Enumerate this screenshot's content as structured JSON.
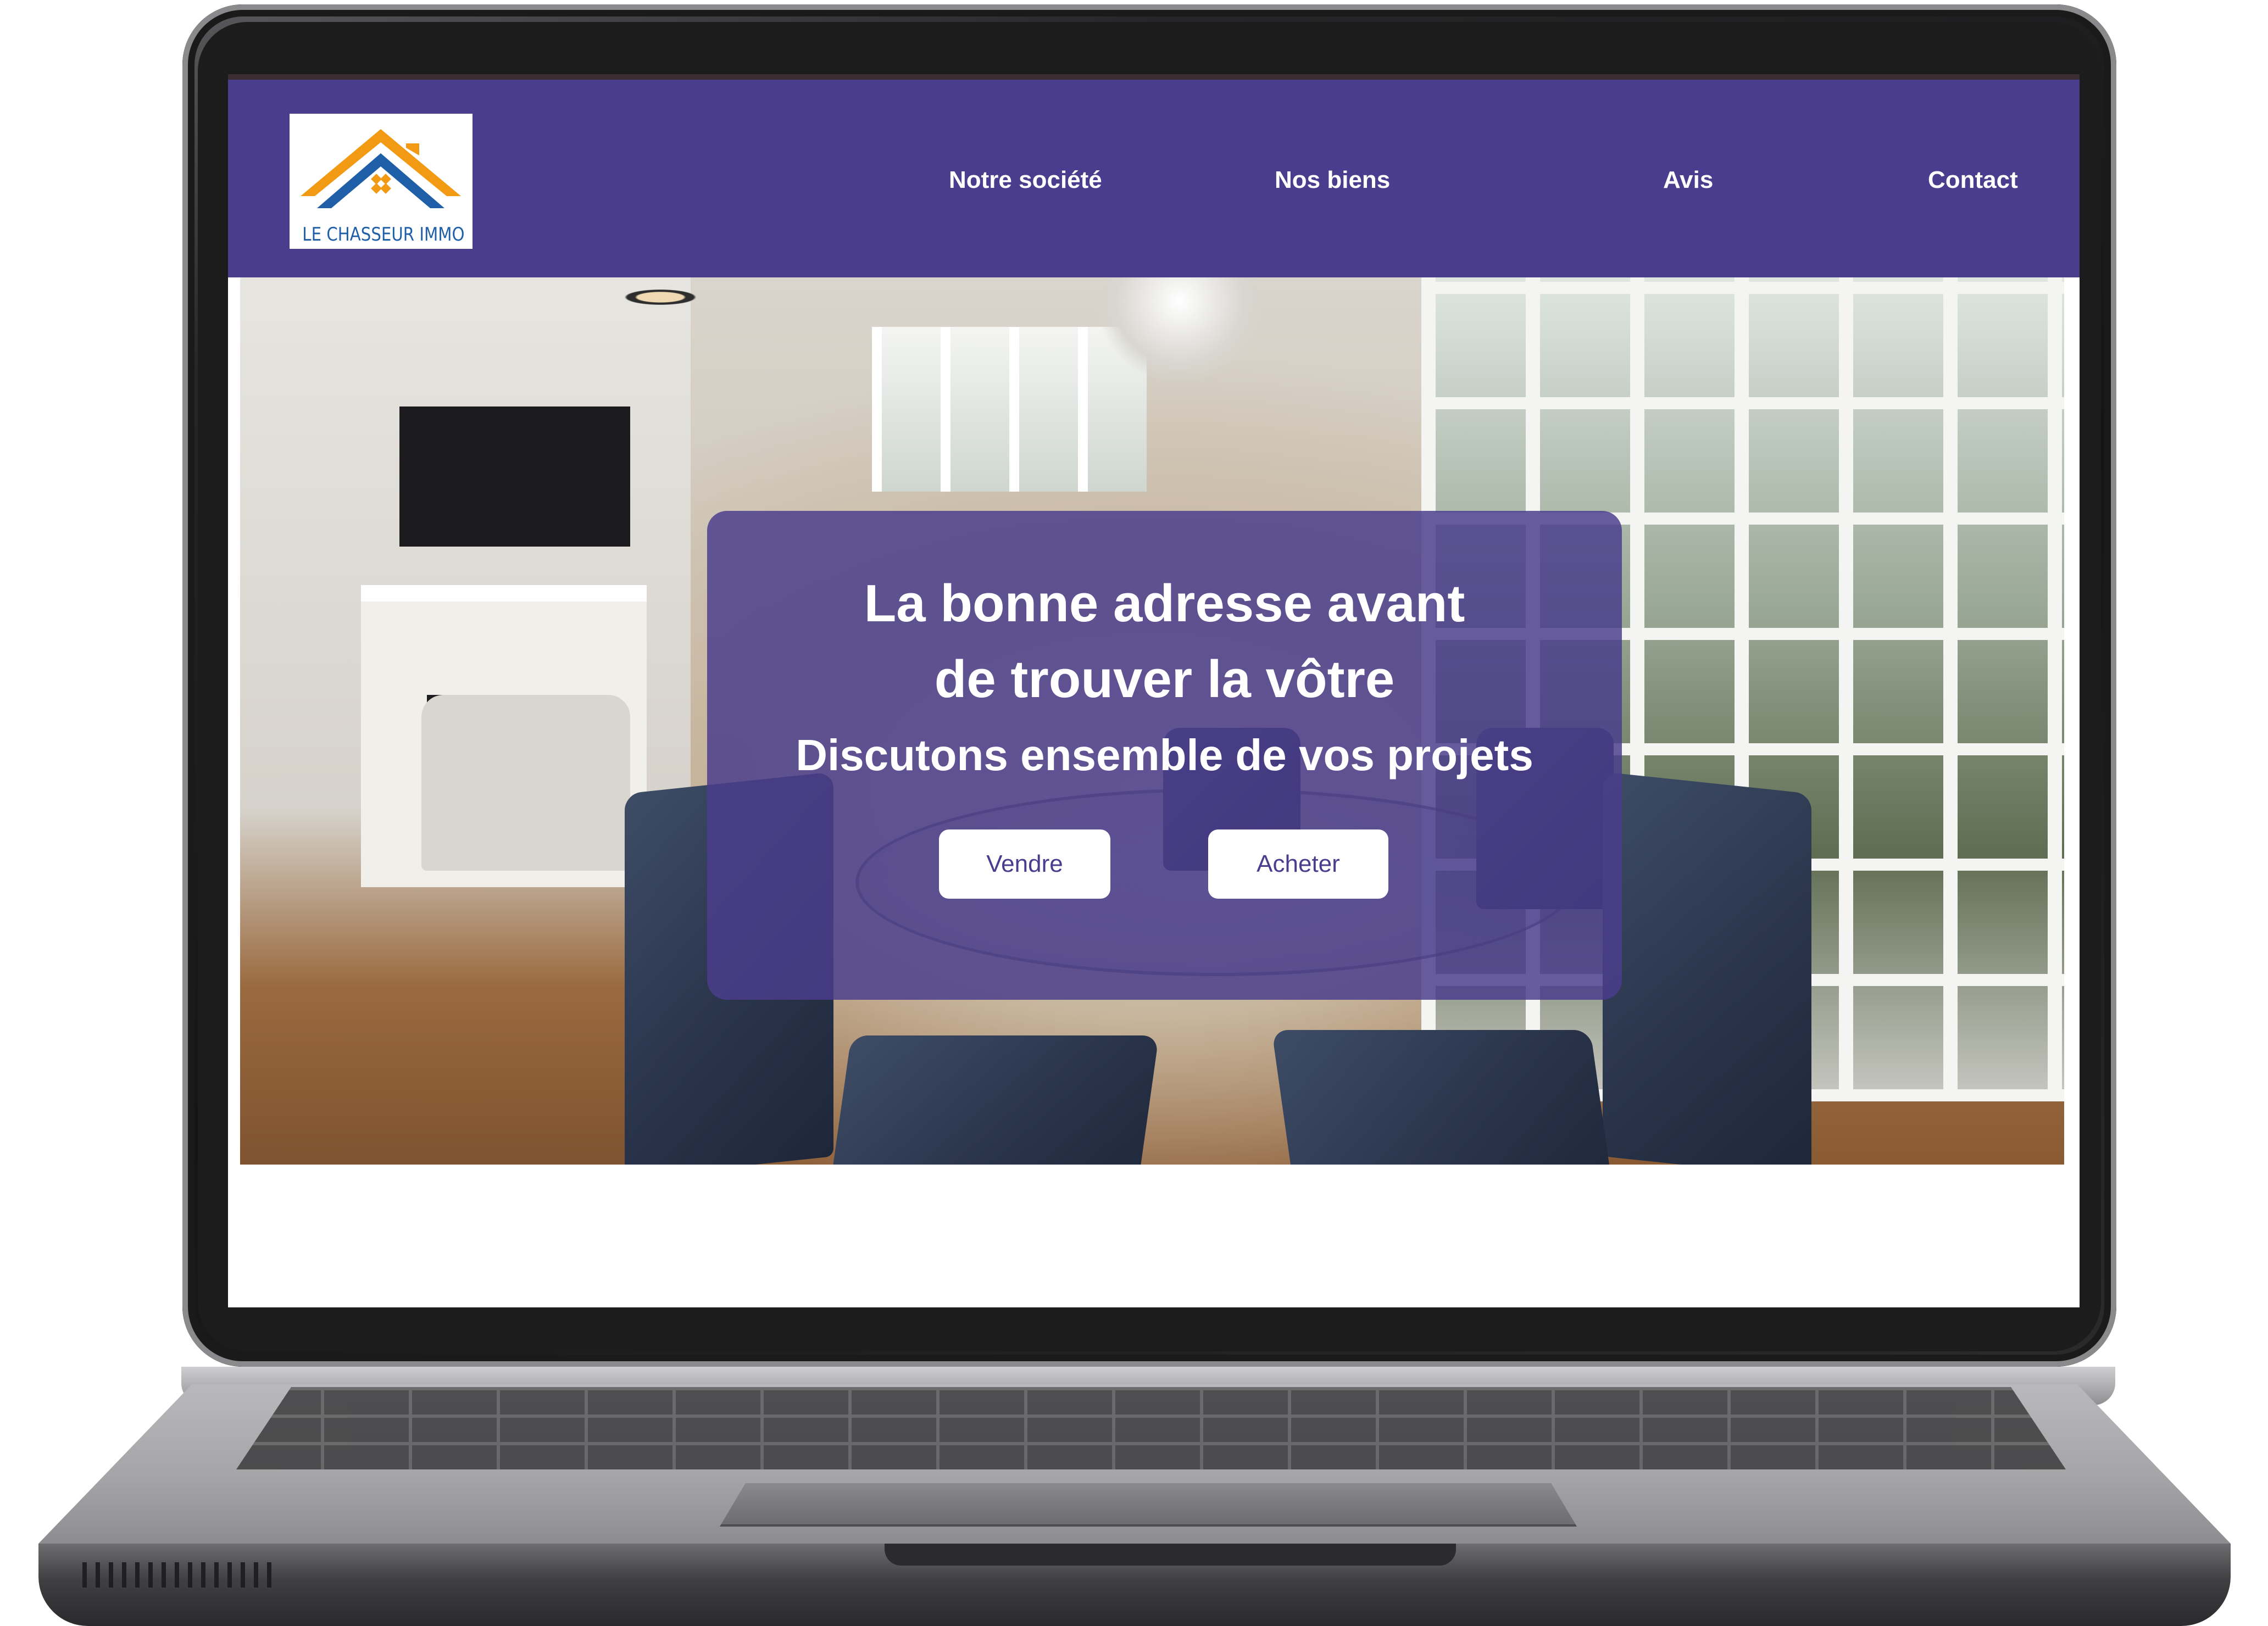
{
  "brand": {
    "logo_text": "LE CHASSEUR IMMO",
    "colors": {
      "primary": "#4a3d8d",
      "logo_orange": "#f29a13",
      "logo_blue": "#1f5fa8"
    }
  },
  "nav": {
    "items": [
      {
        "label": "Notre société"
      },
      {
        "label": "Nos biens"
      },
      {
        "label": "Avis"
      },
      {
        "label": "Contact"
      }
    ]
  },
  "hero": {
    "title": "La bonne adresse avant de trouver la vôtre",
    "subtitle": "Discutons ensemble de vos projets",
    "buttons": {
      "sell": "Vendre",
      "buy": "Acheter"
    }
  }
}
